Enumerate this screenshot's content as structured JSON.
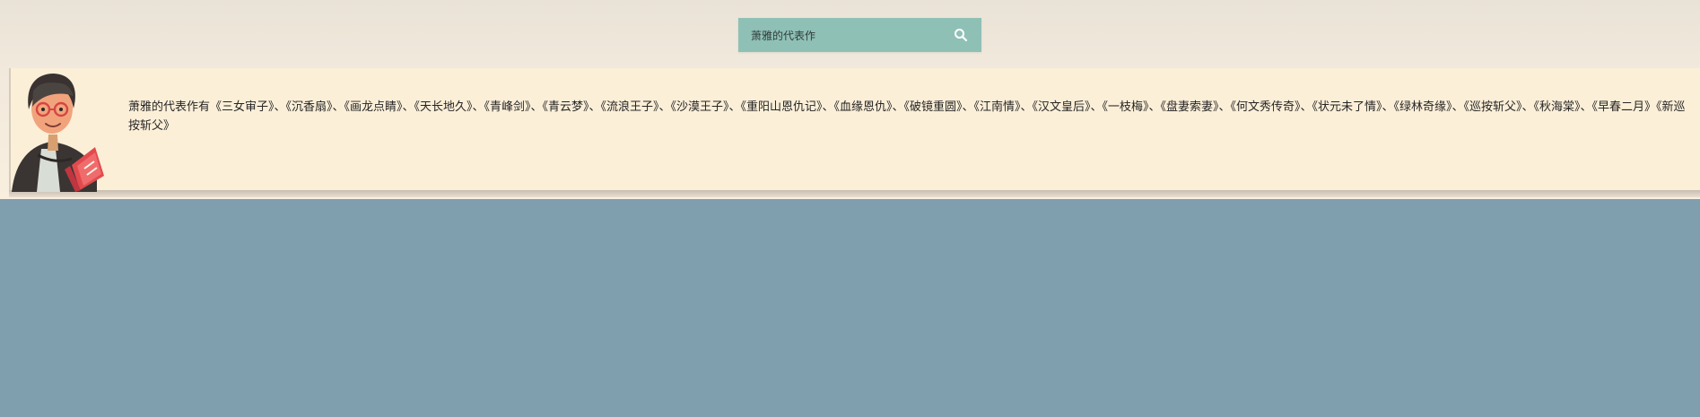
{
  "search": {
    "query": "萧雅的代表作",
    "icon": "search-icon"
  },
  "result": {
    "avatar": "reading-woman-avatar",
    "text": "萧雅的代表作有《三女审子》、《沉香扇》、《画龙点睛》、《天长地久》、《青峰剑》、《青云梦》、《流浪王子》、《沙漠王子》、《重阳山恩仇记》、《血缘恩仇》、《破镜重圆》、《江南情》、《汉文皇后》、《一枝梅》、《盘妻索妻》、《何文秀传奇》、《状元未了情》、《绿林奇缘》、《巡按斩父》、《秋海棠》、《早春二月》《新巡按斩父》"
  },
  "colors": {
    "page_background": "#7f9eae",
    "top_background": "#f1e9dc",
    "search_box": "#8fc0b6",
    "result_background": "#fcefd8"
  }
}
